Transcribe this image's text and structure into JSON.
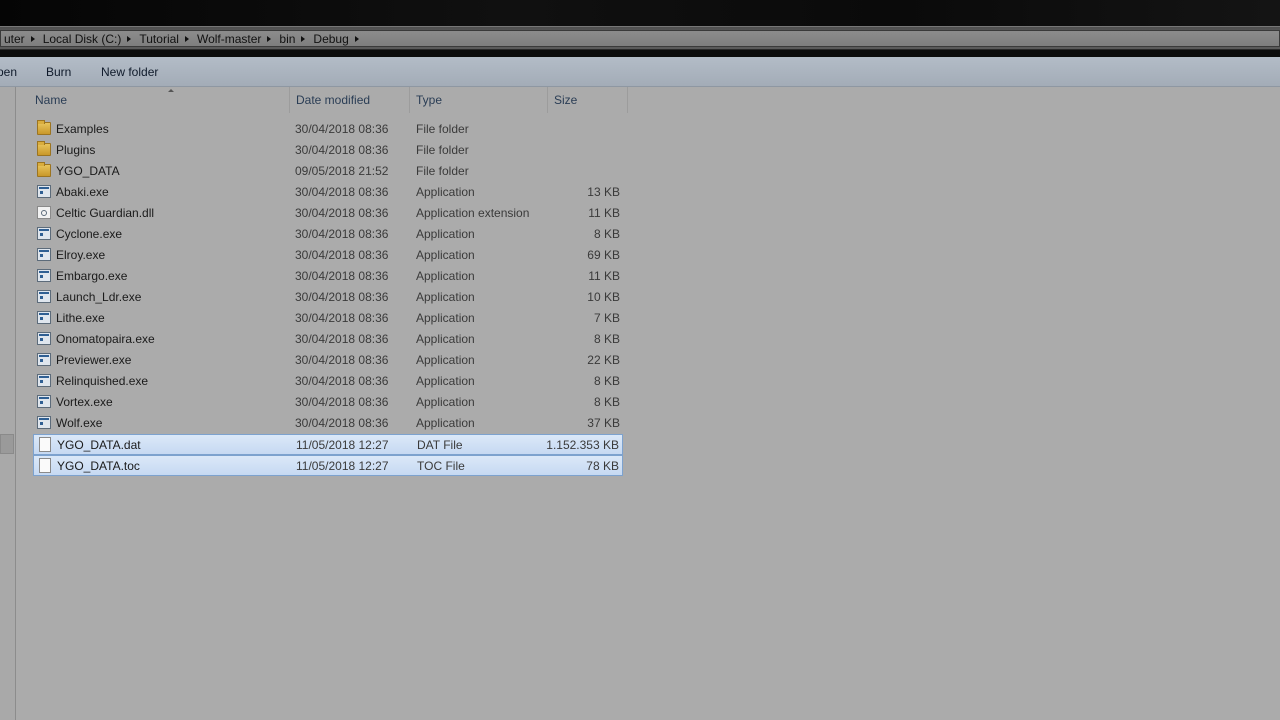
{
  "breadcrumb": [
    "uter",
    "Local Disk (C:)",
    "Tutorial",
    "Wolf-master",
    "bin",
    "Debug"
  ],
  "toolbar": {
    "open_label": "pen",
    "burn_label": "Burn",
    "new_folder_label": "New folder"
  },
  "columns": {
    "name": "Name",
    "date": "Date modified",
    "type": "Type",
    "size": "Size"
  },
  "files": [
    {
      "name": "Examples",
      "date": "30/04/2018 08:36",
      "type": "File folder",
      "size": "",
      "icon": "folder-icon"
    },
    {
      "name": "Plugins",
      "date": "30/04/2018 08:36",
      "type": "File folder",
      "size": "",
      "icon": "folder-icon"
    },
    {
      "name": "YGO_DATA",
      "date": "09/05/2018 21:52",
      "type": "File folder",
      "size": "",
      "icon": "folder-icon"
    },
    {
      "name": "Abaki.exe",
      "date": "30/04/2018 08:36",
      "type": "Application",
      "size": "13 KB",
      "icon": "application-icon"
    },
    {
      "name": "Celtic Guardian.dll",
      "date": "30/04/2018 08:36",
      "type": "Application extension",
      "size": "11 KB",
      "icon": "dll-icon"
    },
    {
      "name": "Cyclone.exe",
      "date": "30/04/2018 08:36",
      "type": "Application",
      "size": "8 KB",
      "icon": "application-icon"
    },
    {
      "name": "Elroy.exe",
      "date": "30/04/2018 08:36",
      "type": "Application",
      "size": "69 KB",
      "icon": "application-icon"
    },
    {
      "name": "Embargo.exe",
      "date": "30/04/2018 08:36",
      "type": "Application",
      "size": "11 KB",
      "icon": "application-icon"
    },
    {
      "name": "Launch_Ldr.exe",
      "date": "30/04/2018 08:36",
      "type": "Application",
      "size": "10 KB",
      "icon": "application-icon"
    },
    {
      "name": "Lithe.exe",
      "date": "30/04/2018 08:36",
      "type": "Application",
      "size": "7 KB",
      "icon": "application-icon"
    },
    {
      "name": "Onomatopaira.exe",
      "date": "30/04/2018 08:36",
      "type": "Application",
      "size": "8 KB",
      "icon": "application-icon"
    },
    {
      "name": "Previewer.exe",
      "date": "30/04/2018 08:36",
      "type": "Application",
      "size": "22 KB",
      "icon": "application-icon"
    },
    {
      "name": "Relinquished.exe",
      "date": "30/04/2018 08:36",
      "type": "Application",
      "size": "8 KB",
      "icon": "application-icon"
    },
    {
      "name": "Vortex.exe",
      "date": "30/04/2018 08:36",
      "type": "Application",
      "size": "8 KB",
      "icon": "application-icon"
    },
    {
      "name": "Wolf.exe",
      "date": "30/04/2018 08:36",
      "type": "Application",
      "size": "37 KB",
      "icon": "application-icon"
    },
    {
      "name": "YGO_DATA.dat",
      "date": "11/05/2018 12:27",
      "type": "DAT File",
      "size": "1.152.353 KB",
      "icon": "file-icon",
      "selected": true
    },
    {
      "name": "YGO_DATA.toc",
      "date": "11/05/2018 12:27",
      "type": "TOC File",
      "size": "78 KB",
      "icon": "file-icon",
      "selected": true
    }
  ],
  "colors": {
    "selection": "#c6d9f2",
    "selection_border": "#7da2ce",
    "background": "#ababab"
  }
}
